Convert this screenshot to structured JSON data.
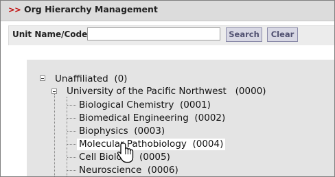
{
  "header": {
    "arrows": ">>",
    "title": "Org Hierarchy Management"
  },
  "search": {
    "label": "Unit Name/Code:",
    "value": "",
    "search_button": "Search",
    "clear_button": "Clear"
  },
  "tree": {
    "root": {
      "label": "Unaffiliated",
      "code": "(0)"
    },
    "org": {
      "label": "University of the Pacific Northwest",
      "code": "(0000)"
    },
    "children": [
      {
        "label": "Biological Chemistry",
        "code": "(0001)"
      },
      {
        "label": "Biomedical Engineering",
        "code": "(0002)"
      },
      {
        "label": "Biophysics",
        "code": "(0003)"
      },
      {
        "label": "Molecular Pathobiology",
        "code": "(0004)"
      },
      {
        "label": "Cell Biology",
        "code": "(0005)"
      },
      {
        "label": "Neuroscience",
        "code": "(0006)"
      }
    ]
  },
  "icons": {
    "expander": "minus-box-icon",
    "cursor": "hand-pointer-icon"
  }
}
